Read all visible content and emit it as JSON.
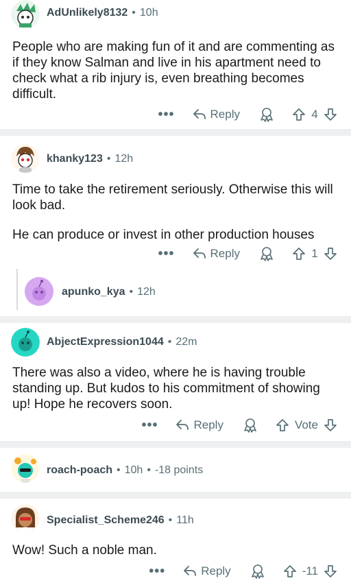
{
  "comments": [
    {
      "username": "AdUnlikely8132",
      "time": "10h",
      "body": [
        "People who are making fun of it and are commenting as if they know Salman and live in his apartment need to check what a rib injury is, even breathing becomes difficult."
      ],
      "reply_label": "Reply",
      "score": "4"
    },
    {
      "username": "khanky123",
      "time": "12h",
      "body": [
        "Time to take the retirement seriously. Otherwise this will look bad.",
        "He can produce or invest in other production houses"
      ],
      "reply_label": "Reply",
      "score": "1"
    },
    {
      "username": "apunko_kya",
      "time": "12h"
    },
    {
      "username": "AbjectExpression1044",
      "time": "22m",
      "body": [
        "There was also a video, where he is having trouble standing up. But kudos to his commitment of showing up! Hope he recovers soon."
      ],
      "reply_label": "Reply",
      "score": "Vote"
    },
    {
      "username": "roach-poach",
      "time": "10h",
      "points": "-18 points"
    },
    {
      "username": "Specialist_Scheme246",
      "time": "11h",
      "body": [
        "Wow! Such a noble man."
      ],
      "reply_label": "Reply",
      "score": "-11"
    }
  ],
  "icons": {
    "more": "more-options-icon",
    "reply": "reply-arrow-icon",
    "award": "award-icon",
    "upvote": "upvote-arrow-icon",
    "downvote": "downvote-arrow-icon"
  },
  "colors": {
    "meta_text": "#576f76",
    "divider": "#edeff1",
    "avatar_purple": "#d6a8f0",
    "avatar_teal": "#25d7c3"
  }
}
